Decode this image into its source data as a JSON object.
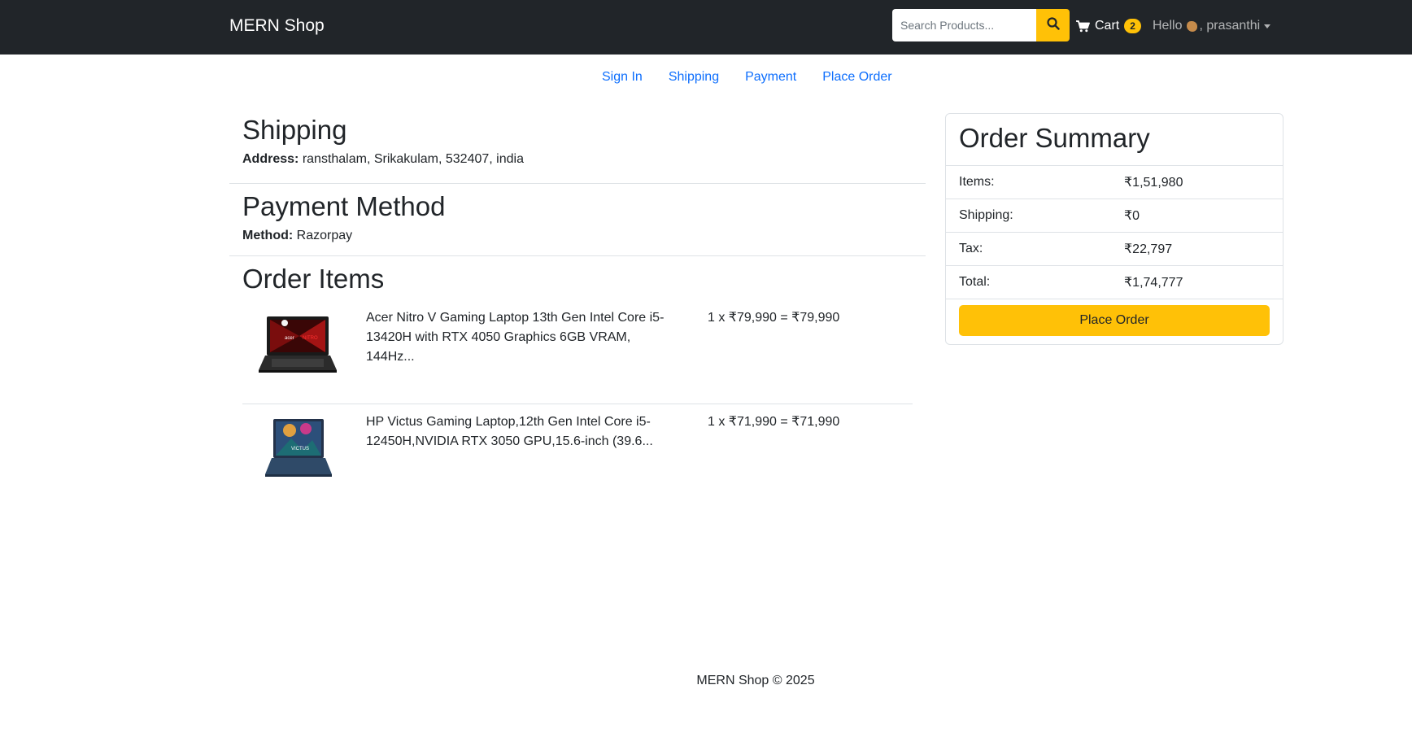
{
  "navbar": {
    "brand": "MERN Shop",
    "search_placeholder": "Search Products...",
    "cart_label": "Cart",
    "cart_count": "2",
    "greeting": "Hello",
    "username": ", prasanthi"
  },
  "steps": [
    "Sign In",
    "Shipping",
    "Payment",
    "Place Order"
  ],
  "shipping": {
    "title": "Shipping",
    "address_label": "Address:",
    "address_value": "ransthalam, Srikakulam, 532407, india"
  },
  "payment": {
    "title": "Payment Method",
    "method_label": "Method:",
    "method_value": "Razorpay"
  },
  "order_items": {
    "title": "Order Items",
    "items": [
      {
        "name": "Acer Nitro V Gaming Laptop 13th Gen Intel Core i5-13420H with RTX 4050 Graphics 6GB VRAM, 144Hz...",
        "price_line": "1 x ₹79,990 = ₹79,990",
        "image_icon": "acer-nitro-laptop-image"
      },
      {
        "name": "HP Victus Gaming Laptop,12th Gen Intel Core i5-12450H,NVIDIA RTX 3050 GPU,15.6-inch (39.6...",
        "price_line": "1 x ₹71,990 = ₹71,990",
        "image_icon": "hp-victus-laptop-image"
      }
    ]
  },
  "summary": {
    "title": "Order Summary",
    "rows": [
      {
        "label": "Items:",
        "value": "₹1,51,980"
      },
      {
        "label": "Shipping:",
        "value": "₹0"
      },
      {
        "label": "Tax:",
        "value": "₹22,797"
      },
      {
        "label": "Total:",
        "value": "₹1,74,777"
      }
    ],
    "button": "Place Order"
  },
  "footer": "MERN Shop © 2025",
  "colors": {
    "navbar": "#212529",
    "accent": "#ffc107",
    "link": "#0d6efd"
  }
}
